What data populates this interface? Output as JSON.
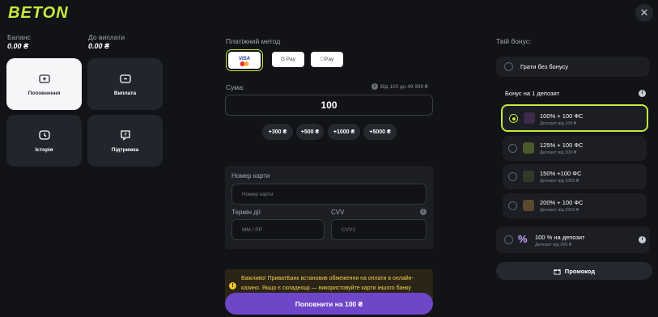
{
  "brand": {
    "logo_text": "BETON",
    "accent": "#c6ea3d",
    "purple": "#6e46c8"
  },
  "header": {
    "close_icon": "close-icon"
  },
  "balances": {
    "balance_label": "Баланс",
    "balance_value": "0.00 ₴",
    "payout_label": "До виплати",
    "payout_value": "0.00 ₴"
  },
  "tiles": [
    {
      "label": "Поповнення",
      "icon": "wallet-plus-icon",
      "active": true
    },
    {
      "label": "Виплата",
      "icon": "wallet-minus-icon",
      "active": false
    },
    {
      "label": "Історія",
      "icon": "history-icon",
      "active": false
    },
    {
      "label": "Підтримка",
      "icon": "support-icon",
      "active": false
    }
  ],
  "payment": {
    "label": "Платіжний метод",
    "methods": [
      {
        "name": "VISA",
        "icon": "visa-mastercard-icon",
        "selected": true
      },
      {
        "name": "G Pay",
        "icon": "google-pay-icon",
        "selected": false
      },
      {
        "name": "Pay",
        "icon": "apple-pay-icon",
        "selected": false
      }
    ]
  },
  "amount": {
    "label": "Сума:",
    "range": "Від 100 до 49 999 ₴",
    "value": "100",
    "chips": [
      "+300 ₴",
      "+500 ₴",
      "+1000 ₴",
      "+5000 ₴"
    ]
  },
  "card": {
    "number_label": "Номер карти",
    "number_placeholder": "Номер карти",
    "expiry_label": "Термін дії",
    "expiry_placeholder": "ММ / РР",
    "cvv_label": "CVV",
    "cvv_placeholder": "CVV2"
  },
  "warning": {
    "text": "Важливо! ПриватБанк встановив обмеження на оплати в онлайн-казино. Якщо є складнощі — використовуйте карти іншого банку"
  },
  "pay_button": "Поповнити на 100 ₴",
  "bonus": {
    "label": "Твій бонус:",
    "no_bonus": "Грати без бонусу",
    "first_deposit_label": "Бонус на 1 депозит",
    "offers": [
      {
        "title": "100% + 100 ФС",
        "sub": "Депозит від 100 ₴",
        "selected": true
      },
      {
        "title": "125% + 100 ФС",
        "sub": "Депозит від 300 ₴",
        "selected": false
      },
      {
        "title": "150% +100 ФС",
        "sub": "Депозит від 1000 ₴",
        "selected": false
      },
      {
        "title": "200% + 100 ФС",
        "sub": "Депозит від 2500 ₴",
        "selected": false
      }
    ],
    "deposit_offer": {
      "title": "100 % на депозит",
      "sub": "Депозит від 200 ₴"
    },
    "promo_button": "Промокод"
  }
}
